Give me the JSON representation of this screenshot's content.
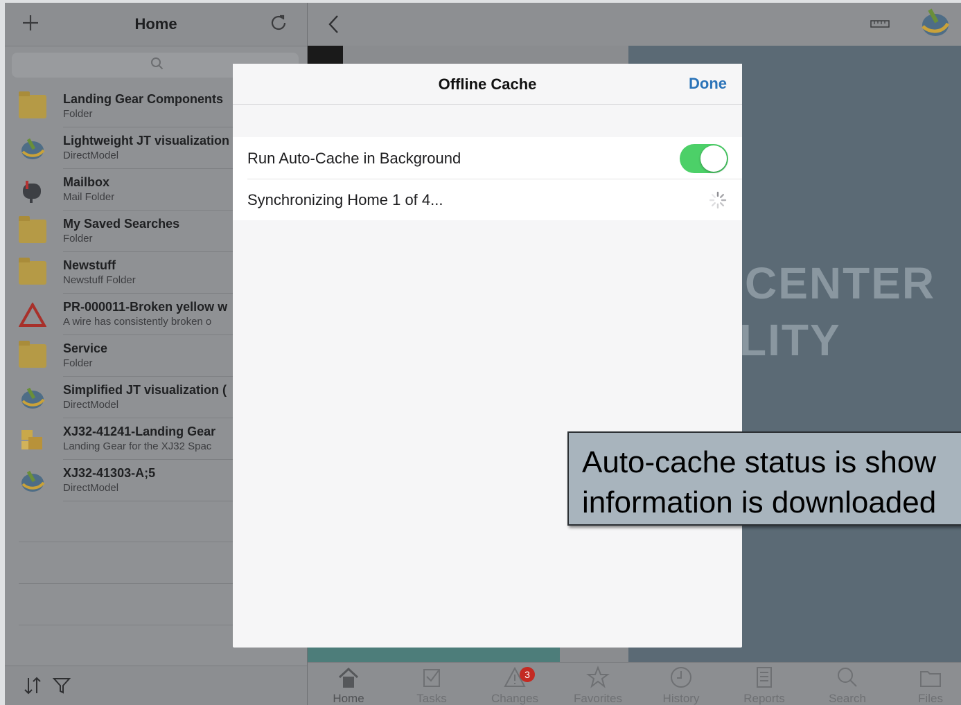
{
  "left_panel": {
    "title": "Home",
    "add_icon": "plus-icon",
    "refresh_icon": "refresh-icon",
    "search_icon": "search-icon",
    "items": [
      {
        "name": "Landing Gear Components",
        "sub": "Folder",
        "icon": "folder-icon"
      },
      {
        "name": "Lightweight JT visualization",
        "sub": "DirectModel",
        "icon": "directmodel-icon"
      },
      {
        "name": "Mailbox",
        "sub": "Mail Folder",
        "icon": "mailbox-icon"
      },
      {
        "name": "My Saved Searches",
        "sub": "Folder",
        "icon": "folder-icon"
      },
      {
        "name": "Newstuff",
        "sub": "Newstuff Folder",
        "icon": "folder-icon"
      },
      {
        "name": "PR-000011-Broken yellow w",
        "sub": "A wire has consistently broken o",
        "icon": "warning-icon"
      },
      {
        "name": "Service",
        "sub": "Folder",
        "icon": "folder-icon"
      },
      {
        "name": "Simplified JT visualization (",
        "sub": "DirectModel",
        "icon": "directmodel-icon"
      },
      {
        "name": "XJ32-41241-Landing Gear",
        "sub": "Landing Gear for the XJ32 Spac",
        "icon": "assembly-icon"
      },
      {
        "name": "XJ32-41303-A;5",
        "sub": "DirectModel",
        "icon": "directmodel-icon"
      }
    ],
    "footer": {
      "sort_icon": "sort-icon",
      "filter_icon": "filter-icon"
    }
  },
  "right_panel": {
    "back_icon": "chevron-left-icon",
    "ruler_icon": "ruler-icon",
    "app_logo": "app-logo-icon",
    "background_text": {
      "line1": "CENTER",
      "line2": "LITY"
    }
  },
  "modal": {
    "title": "Offline Cache",
    "done_label": "Done",
    "rows": [
      {
        "label": "Run Auto-Cache in Background",
        "control": "toggle",
        "value": true
      },
      {
        "label": "Synchronizing Home 1 of 4...",
        "control": "spinner"
      }
    ],
    "toggle_color": "#4cd068",
    "accent_color": "#2a73b8"
  },
  "tabbar": {
    "tabs": [
      {
        "label": "Home",
        "icon": "house-icon"
      },
      {
        "label": "Tasks",
        "icon": "checkbox-icon"
      },
      {
        "label": "Changes",
        "icon": "warning-icon",
        "badge": "3"
      },
      {
        "label": "Favorites",
        "icon": "star-icon"
      },
      {
        "label": "History",
        "icon": "clock-icon"
      },
      {
        "label": "Reports",
        "icon": "document-icon"
      },
      {
        "label": "Search",
        "icon": "search-icon"
      },
      {
        "label": "Files",
        "icon": "folder-icon"
      }
    ]
  },
  "callout": {
    "line1": "Auto-cache status is show",
    "line2": "information is downloaded"
  }
}
